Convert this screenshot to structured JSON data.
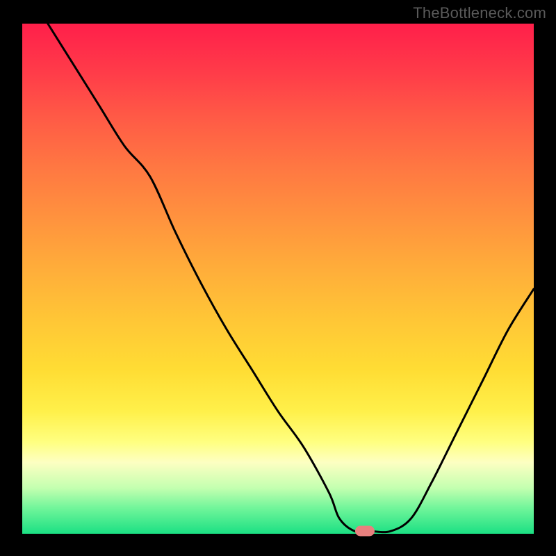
{
  "watermark": "TheBottleneck.com",
  "chart_data": {
    "type": "line",
    "title": "",
    "xlabel": "",
    "ylabel": "",
    "xlim": [
      0,
      100
    ],
    "ylim": [
      0,
      100
    ],
    "grid": false,
    "legend": false,
    "background_gradient": {
      "top": "#ff1f4a",
      "mid": "#ffdd34",
      "bottom": "#1be083"
    },
    "series": [
      {
        "name": "curve",
        "color": "#000000",
        "x": [
          5,
          10,
          15,
          20,
          25,
          30,
          35,
          40,
          45,
          50,
          55,
          60,
          62,
          65,
          68,
          72,
          76,
          80,
          85,
          90,
          95,
          100
        ],
        "y": [
          100,
          92,
          84,
          76,
          70,
          59,
          49,
          40,
          32,
          24,
          17,
          8,
          3,
          0.5,
          0.5,
          0.5,
          3,
          10,
          20,
          30,
          40,
          48
        ]
      }
    ],
    "marker": {
      "name": "selected-point",
      "color": "#e8807e",
      "x": 67,
      "y": 0.5
    }
  }
}
